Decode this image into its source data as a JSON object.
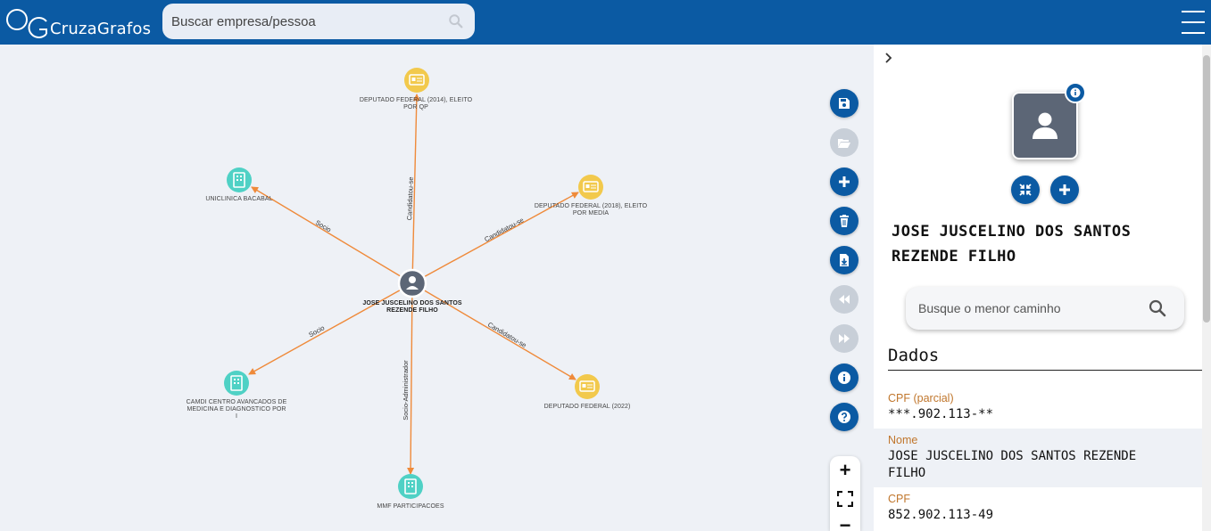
{
  "header": {
    "logo_text": "CruzaGrafos",
    "search_placeholder": "Buscar empresa/pessoa"
  },
  "graph": {
    "center": {
      "label": "JOSE JUSCELINO DOS SANTOS REZENDE FILHO",
      "line1": "JOSE JUSCELINO DOS SANTOS",
      "line2": "REZENDE FILHO",
      "type": "person-icon"
    },
    "nodes": [
      {
        "id": "dep2014",
        "type": "candidacy-card-icon",
        "line1": "DEPUTADO FEDERAL (2014), ELEITO",
        "line2": "POR QP",
        "edge_label": "Candidatou-se"
      },
      {
        "id": "dep2018",
        "type": "candidacy-card-icon",
        "line1": "DEPUTADO FEDERAL (2018), ELEITO",
        "line2": "POR MEDIA",
        "edge_label": "Candidatou-se"
      },
      {
        "id": "dep2022",
        "type": "candidacy-card-icon",
        "line1": "DEPUTADO FEDERAL (2022)",
        "line2": "",
        "edge_label": "Candidatou-se"
      },
      {
        "id": "uniclinica",
        "type": "company-building-icon",
        "line1": "UNICLINICA BACABAL",
        "line2": "",
        "edge_label": "Socio"
      },
      {
        "id": "camdi",
        "type": "company-building-icon",
        "line1": "CAMDI CENTRO AVANCADOS DE",
        "line2": "MEDICINA E DIAGNOSTICO POR",
        "line3": "I",
        "edge_label": "Socio"
      },
      {
        "id": "mmf",
        "type": "company-building-icon",
        "line1": "MMF PARTICIPACOES",
        "line2": "",
        "edge_label": "Socio-Administrador"
      }
    ]
  },
  "toolbar": {
    "buttons": [
      {
        "name": "save-button",
        "icon": "save-icon",
        "enabled": true
      },
      {
        "name": "open-folder-button",
        "icon": "folder-open-icon",
        "enabled": false
      },
      {
        "name": "add-button",
        "icon": "plus-icon",
        "enabled": true
      },
      {
        "name": "delete-button",
        "icon": "trash-icon",
        "enabled": true
      },
      {
        "name": "export-button",
        "icon": "file-download-icon",
        "enabled": true
      },
      {
        "name": "undo-button",
        "icon": "rewind-icon",
        "enabled": false
      },
      {
        "name": "redo-button",
        "icon": "fast-forward-icon",
        "enabled": false
      },
      {
        "name": "info-button",
        "icon": "info-icon",
        "enabled": true
      },
      {
        "name": "help-button",
        "icon": "question-icon",
        "enabled": true
      }
    ],
    "zoom": {
      "zoom_in": "+",
      "fit": "fit-icon",
      "zoom_out": "−"
    }
  },
  "panel": {
    "name": "JOSE JUSCELINO DOS SANTOS REZENDE FILHO",
    "name_line1": "JOSE JUSCELINO DOS SANTOS",
    "name_line2": "REZENDE FILHO",
    "path_search_placeholder": "Busque o menor caminho",
    "section_title": "Dados",
    "fields": [
      {
        "label": "CPF (parcial)",
        "value": "***.902.113-**"
      },
      {
        "label": "Nome",
        "value_line1": "JOSE JUSCELINO DOS SANTOS REZENDE",
        "value_line2": "FILHO"
      },
      {
        "label": "CPF",
        "value": "852.902.113-49"
      }
    ]
  },
  "colors": {
    "header": "#0b5aa3",
    "edge": "#ef8a3a",
    "company_node": "#4fd1c5",
    "candidacy_node": "#f2c94c",
    "person_node": "#5c6676",
    "label_orange": "#c0762c"
  }
}
